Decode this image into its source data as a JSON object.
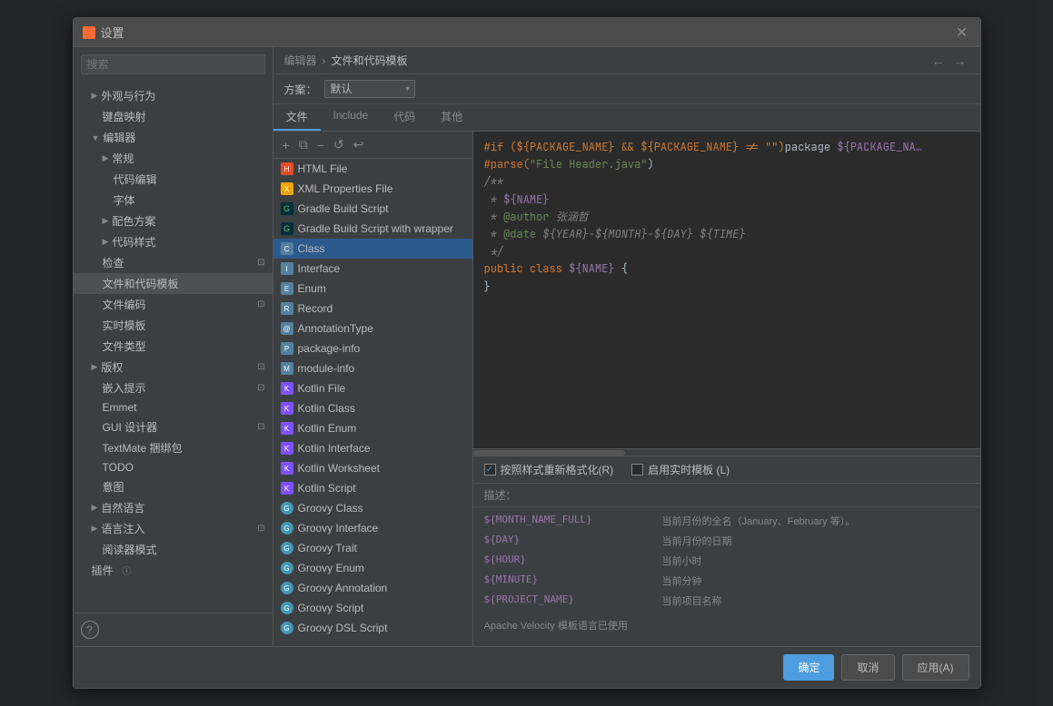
{
  "dialog": {
    "title": "设置",
    "close_label": "✕"
  },
  "breadcrumb": {
    "parent": "编辑器",
    "separator": "›",
    "current": "文件和代码模板",
    "nav_back": "←",
    "nav_fwd": "→"
  },
  "scheme": {
    "label": "方案：",
    "value": "默认",
    "options": [
      "默认"
    ]
  },
  "tabs": [
    {
      "id": "files",
      "label": "文件",
      "active": true
    },
    {
      "id": "include",
      "label": "Include",
      "active": false
    },
    {
      "id": "code",
      "label": "代码",
      "active": false
    },
    {
      "id": "other",
      "label": "其他",
      "active": false
    }
  ],
  "toolbar": {
    "add": "+",
    "copy": "⧉",
    "remove": "−",
    "reset": "↺",
    "undo": "↩"
  },
  "file_list": {
    "items": [
      {
        "id": "html-file",
        "icon_type": "html",
        "label": "HTML File"
      },
      {
        "id": "xml-properties-file",
        "icon_type": "xml",
        "label": "XML Properties File"
      },
      {
        "id": "gradle-build-script",
        "icon_type": "gradle",
        "label": "Gradle Build Script"
      },
      {
        "id": "gradle-build-script-wrapper",
        "icon_type": "gradle",
        "label": "Gradle Build Script with wrapper"
      },
      {
        "id": "class",
        "icon_type": "java",
        "label": "Class",
        "selected": true
      },
      {
        "id": "interface",
        "icon_type": "java",
        "label": "Interface"
      },
      {
        "id": "enum",
        "icon_type": "java",
        "label": "Enum"
      },
      {
        "id": "record",
        "icon_type": "java",
        "label": "Record"
      },
      {
        "id": "annotation-type",
        "icon_type": "java",
        "label": "AnnotationType"
      },
      {
        "id": "package-info",
        "icon_type": "java",
        "label": "package-info"
      },
      {
        "id": "module-info",
        "icon_type": "java",
        "label": "module-info"
      },
      {
        "id": "kotlin-file",
        "icon_type": "kotlin",
        "label": "Kotlin File"
      },
      {
        "id": "kotlin-class",
        "icon_type": "kotlin",
        "label": "Kotlin Class"
      },
      {
        "id": "kotlin-enum",
        "icon_type": "kotlin",
        "label": "Kotlin Enum"
      },
      {
        "id": "kotlin-interface",
        "icon_type": "kotlin",
        "label": "Kotlin Interface"
      },
      {
        "id": "kotlin-worksheet",
        "icon_type": "kotlin",
        "label": "Kotlin Worksheet"
      },
      {
        "id": "kotlin-script",
        "icon_type": "kotlin",
        "label": "Kotlin Script"
      },
      {
        "id": "groovy-class",
        "icon_type": "groovy",
        "label": "Groovy Class"
      },
      {
        "id": "groovy-interface",
        "icon_type": "groovy",
        "label": "Groovy Interface"
      },
      {
        "id": "groovy-trait",
        "icon_type": "groovy",
        "label": "Groovy Trait"
      },
      {
        "id": "groovy-enum",
        "icon_type": "groovy",
        "label": "Groovy Enum"
      },
      {
        "id": "groovy-annotation",
        "icon_type": "groovy",
        "label": "Groovy Annotation"
      },
      {
        "id": "groovy-script",
        "icon_type": "groovy",
        "label": "Groovy Script"
      },
      {
        "id": "groovy-dsl-script",
        "icon_type": "groovy",
        "label": "Groovy DSL Script"
      }
    ]
  },
  "code_template": {
    "lines": [
      {
        "parts": [
          {
            "text": "#if (${PACKAGE_NAME} && ${PACKAGE_NAME} != \"\")",
            "class": "c-keyword"
          },
          {
            "text": "package ",
            "class": "c-default"
          },
          {
            "text": "${PACKAGE_NA…",
            "class": "c-var"
          }
        ]
      },
      {
        "parts": [
          {
            "text": "#parse(",
            "class": "c-keyword"
          },
          {
            "text": "\"File Header.java\"",
            "class": "c-string"
          },
          {
            "text": ")",
            "class": "c-default"
          }
        ]
      },
      {
        "parts": [
          {
            "text": "/**",
            "class": "c-comment"
          }
        ]
      },
      {
        "parts": [
          {
            "text": " * ",
            "class": "c-comment"
          },
          {
            "text": "${NAME}",
            "class": "c-var"
          }
        ]
      },
      {
        "parts": [
          {
            "text": " * ",
            "class": "c-comment"
          },
          {
            "text": "@author",
            "class": "c-annotation"
          },
          {
            "text": " 张涵哲",
            "class": "c-comment"
          }
        ]
      },
      {
        "parts": [
          {
            "text": " * ",
            "class": "c-comment"
          },
          {
            "text": "@date",
            "class": "c-annotation"
          },
          {
            "text": " ${YEAR}-${MONTH}-${DAY} ${TIME}",
            "class": "c-comment"
          }
        ]
      },
      {
        "parts": [
          {
            "text": " */",
            "class": "c-comment"
          }
        ]
      },
      {
        "parts": [
          {
            "text": "public ",
            "class": "c-keyword"
          },
          {
            "text": "class ",
            "class": "c-keyword"
          },
          {
            "text": "${NAME}",
            "class": "c-var"
          },
          {
            "text": " {",
            "class": "c-default"
          }
        ]
      },
      {
        "parts": [
          {
            "text": "}",
            "class": "c-default"
          }
        ]
      }
    ]
  },
  "options": {
    "reformat_checkbox_checked": true,
    "reformat_label": "按照样式重新格式化(R)",
    "realtime_checkbox_checked": false,
    "realtime_label": "启用实时模板 (L)"
  },
  "description": {
    "title": "描述：",
    "rows": [
      {
        "key": "${MONTH_NAME_FULL}",
        "value": "当前月份的全名（January、February 等）。"
      },
      {
        "key": "${DAY}",
        "value": "当前月份的日期"
      },
      {
        "key": "${HOUR}",
        "value": "当前小时"
      },
      {
        "key": "${MINUTE}",
        "value": "当前分钟"
      },
      {
        "key": "${PROJECT_NAME}",
        "value": "当前项目名称"
      }
    ],
    "footer": "Apache Velocity 模板语言已使用"
  },
  "footer_buttons": {
    "ok": "确定",
    "cancel": "取消",
    "apply": "应用(A)"
  },
  "left_nav": {
    "search_placeholder": "搜索",
    "items": [
      {
        "label": "外观与行为",
        "indent": 1,
        "expandable": true
      },
      {
        "label": "键盘映射",
        "indent": 2,
        "expandable": false
      },
      {
        "label": "编辑器",
        "indent": 1,
        "expandable": true,
        "expanded": true
      },
      {
        "label": "常规",
        "indent": 2,
        "expandable": true
      },
      {
        "label": "代码编辑",
        "indent": 3,
        "expandable": false
      },
      {
        "label": "字体",
        "indent": 3,
        "expandable": false
      },
      {
        "label": "配色方案",
        "indent": 2,
        "expandable": true
      },
      {
        "label": "代码样式",
        "indent": 2,
        "expandable": true
      },
      {
        "label": "检查",
        "indent": 2,
        "expandable": false
      },
      {
        "label": "文件和代码模板",
        "indent": 2,
        "expandable": false,
        "selected": true
      },
      {
        "label": "文件编码",
        "indent": 2,
        "expandable": false
      },
      {
        "label": "实时模板",
        "indent": 2,
        "expandable": false
      },
      {
        "label": "文件类型",
        "indent": 2,
        "expandable": false
      },
      {
        "label": "版权",
        "indent": 1,
        "expandable": true
      },
      {
        "label": "嵌入提示",
        "indent": 2,
        "expandable": false
      },
      {
        "label": "Emmet",
        "indent": 2,
        "expandable": false
      },
      {
        "label": "GUI 设计器",
        "indent": 2,
        "expandable": false
      },
      {
        "label": "TextMate 捆绑包",
        "indent": 2,
        "expandable": false
      },
      {
        "label": "TODO",
        "indent": 2,
        "expandable": false
      },
      {
        "label": "意图",
        "indent": 2,
        "expandable": false
      },
      {
        "label": "自然语言",
        "indent": 1,
        "expandable": true
      },
      {
        "label": "语言注入",
        "indent": 1,
        "expandable": true
      },
      {
        "label": "阅读器模式",
        "indent": 2,
        "expandable": false
      },
      {
        "label": "插件",
        "indent": 1,
        "expandable": false
      }
    ]
  }
}
